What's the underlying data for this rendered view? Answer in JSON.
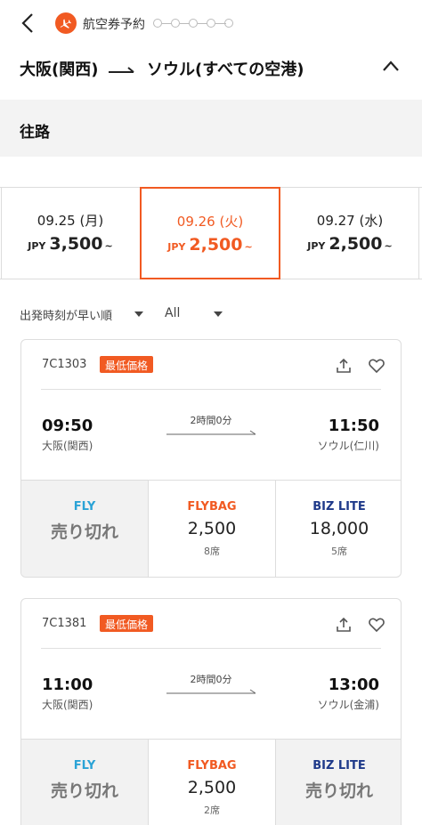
{
  "header": {
    "step_title": "航空券予約",
    "steps_total": 5,
    "current_step": 1
  },
  "route": {
    "from": "大阪(関西)",
    "to": "ソウル(すべての空港)"
  },
  "section": {
    "title": "往路"
  },
  "dates": [
    {
      "date": "09.25 (月)",
      "currency": "JPY",
      "price": "3,500",
      "suffix": "~",
      "selected": false
    },
    {
      "date": "09.26 (火)",
      "currency": "JPY",
      "price": "2,500",
      "suffix": "~",
      "selected": true
    },
    {
      "date": "09.27 (水)",
      "currency": "JPY",
      "price": "2,500",
      "suffix": "~",
      "selected": false
    }
  ],
  "filters": {
    "sort_label": "出発時刻が早い順",
    "filter_value": "All"
  },
  "flights": [
    {
      "flight_no": "7C1303",
      "badge": "最低価格",
      "dep_time": "09:50",
      "dep_airport": "大阪(関西)",
      "duration": "2時間0分",
      "arr_time": "11:50",
      "arr_airport": "ソウル(仁川)",
      "fares": [
        {
          "class": "FLY",
          "value": "売り切れ",
          "seats": "",
          "sold_out": true
        },
        {
          "class": "FLYBAG",
          "value": "2,500",
          "seats": "8席",
          "sold_out": false
        },
        {
          "class": "BIZ LITE",
          "value": "18,000",
          "seats": "5席",
          "sold_out": false
        }
      ]
    },
    {
      "flight_no": "7C1381",
      "badge": "最低価格",
      "dep_time": "11:00",
      "dep_airport": "大阪(関西)",
      "duration": "2時間0分",
      "arr_time": "13:00",
      "arr_airport": "ソウル(金浦)",
      "fares": [
        {
          "class": "FLY",
          "value": "売り切れ",
          "seats": "",
          "sold_out": true
        },
        {
          "class": "FLYBAG",
          "value": "2,500",
          "seats": "2席",
          "sold_out": false
        },
        {
          "class": "BIZ LITE",
          "value": "売り切れ",
          "seats": "",
          "sold_out": true
        }
      ]
    }
  ],
  "colors": {
    "accent": "#f15a22",
    "fly": "#2ba3d6",
    "flybag": "#f15a22",
    "biz_lite": "#1f3a8a"
  }
}
